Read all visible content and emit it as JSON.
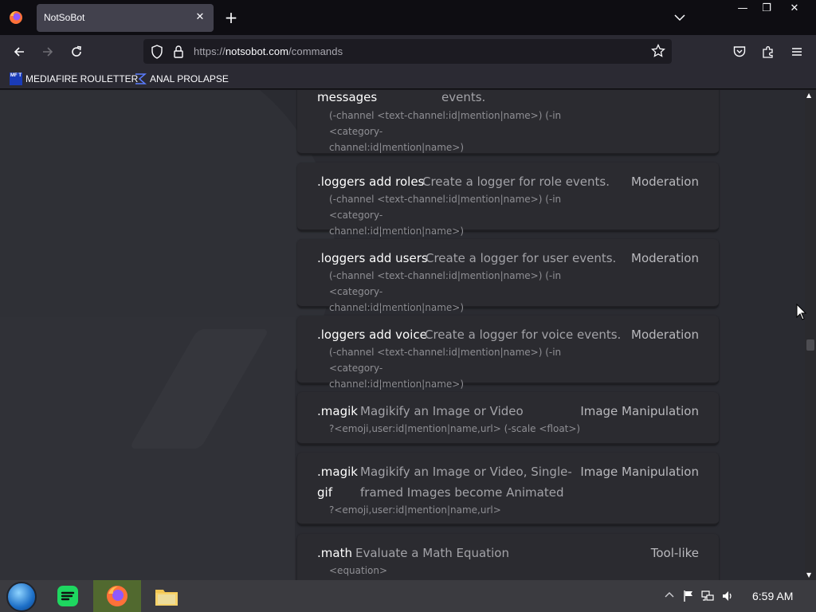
{
  "browser": {
    "tab_title": "NotSoBot",
    "tab_close": "✕",
    "new_tab": "+",
    "window_controls": {
      "minimize": "—",
      "restore": "❐",
      "close": "✕"
    },
    "url_prefix": "https://",
    "url_host": "notsobot.com",
    "url_path": "/commands"
  },
  "bookmarks": [
    {
      "label": "MEDIAFIRE ROULETTER",
      "icon": "mediafire-icon",
      "icon_text": "MF T"
    },
    {
      "label": "ANAL PROLAPSE",
      "icon": "sigma-icon"
    }
  ],
  "commands": [
    {
      "cmd_line1": "",
      "cmd_line2": "messages",
      "desc_line2": "events.",
      "usage_line1": "(-channel <text-channel:id|mention|name>) (-in <category-",
      "usage_line2": "channel:id|mention|name>)"
    },
    {
      "cmd": ".loggers add roles",
      "desc": "Create a logger for role events.",
      "category": "Moderation",
      "usage_line1": "(-channel <text-channel:id|mention|name>) (-in <category-",
      "usage_line2": "channel:id|mention|name>)"
    },
    {
      "cmd": ".loggers add users",
      "desc": "Create a logger for user events.",
      "category": "Moderation",
      "usage_line1": "(-channel <text-channel:id|mention|name>) (-in <category-",
      "usage_line2": "channel:id|mention|name>)"
    },
    {
      "cmd": ".loggers add voice",
      "desc": "Create a logger for voice events.",
      "category": "Moderation",
      "usage_line1": "(-channel <text-channel:id|mention|name>) (-in <category-",
      "usage_line2": "channel:id|mention|name>)"
    },
    {
      "cmd": ".magik",
      "desc": "Magikify an Image or Video",
      "category": "Image Manipulation",
      "usage_line1": "?<emoji,user:id|mention|name,url> (-scale <float>)"
    },
    {
      "cmd_line1": ".magik",
      "cmd_line2": "gif",
      "desc_line1": "Magikify an Image or Video, Single-",
      "desc_line2": "framed Images become Animated",
      "category": "Image Manipulation",
      "usage_line1": "?<emoji,user:id|mention|name,url>"
    },
    {
      "cmd": ".math",
      "desc": "Evaluate a Math Equation",
      "category": "Tool-like",
      "usage_line1": "<equation>"
    }
  ],
  "taskbar": {
    "clock": "6:59 AM",
    "apps": [
      "start-orb",
      "spotify",
      "firefox",
      "file-explorer"
    ],
    "tray": [
      "chevron-up-icon",
      "flag-icon",
      "network-icon",
      "volume-icon"
    ]
  },
  "colors": {
    "tab_bg": "#42414d",
    "toolbar_bg": "#2b2a33",
    "card_bg": "#2b2b30",
    "page_bg": "#2a2b31",
    "taskbar_bg": "#3b3b40",
    "active_app": "#51692f"
  }
}
